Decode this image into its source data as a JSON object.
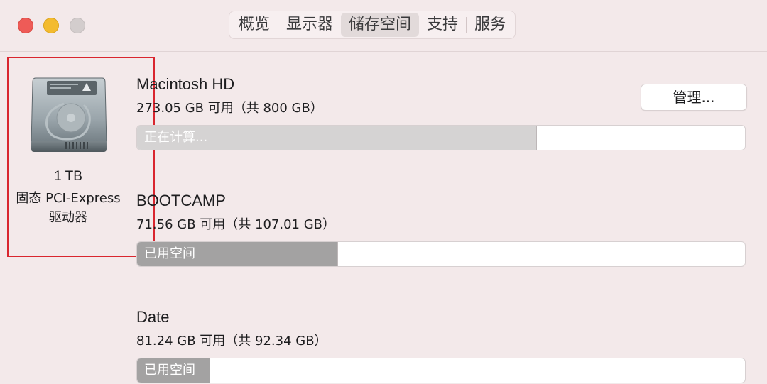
{
  "window": {
    "controls": {
      "close_icon": "close-icon",
      "minimize_icon": "minimize-icon",
      "zoom_icon": "zoom-icon"
    }
  },
  "tabs": [
    {
      "label": "概览",
      "active": false
    },
    {
      "label": "显示器",
      "active": false
    },
    {
      "label": "储存空间",
      "active": true
    },
    {
      "label": "支持",
      "active": false
    },
    {
      "label": "服务",
      "active": false
    }
  ],
  "drive": {
    "icon": "hard-drive-icon",
    "capacity": "1 TB",
    "type_line1": "固态 PCI-Express",
    "type_line2": "驱动器"
  },
  "manage_button": "管理...",
  "volumes": [
    {
      "name": "Macintosh HD",
      "capacity": "273.05 GB 可用（共 800 GB）",
      "bar_label": "正在计算...",
      "fill_fraction": 0.658,
      "fill_color": "#d5d3d3"
    },
    {
      "name": "BOOTCAMP",
      "capacity": "71.56 GB 可用（共 107.01 GB）",
      "bar_label": "已用空间",
      "fill_fraction": 0.331,
      "fill_color": "#a3a2a2"
    },
    {
      "name": "Date",
      "capacity": "81.24 GB 可用（共 92.34 GB）",
      "bar_label": "已用空间",
      "fill_fraction": 0.12,
      "fill_color": "#a3a2a2"
    }
  ],
  "colors": {
    "window_bg": "#f3e9ea",
    "highlight_box": "#d9262f",
    "close": "#ee5b57",
    "minimize": "#f3bb2f",
    "zoom": "#d3cdcd"
  }
}
